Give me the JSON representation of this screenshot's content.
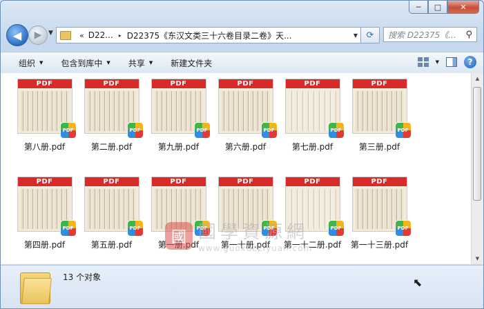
{
  "window": {
    "caption": {
      "minimize": "─",
      "maximize": "□",
      "close": "✕"
    }
  },
  "nav": {
    "back": "◀",
    "forward": "▶",
    "history_dropdown": "▼",
    "address": {
      "overflow": "«",
      "crumb1": "D22...",
      "separator": "▸",
      "crumb2": "D22375《东汉文类三十六卷目录二卷》天...",
      "dropdown": "▼"
    },
    "refresh": "⟳",
    "search_placeholder": "搜索 D22375《...",
    "search_icon": "⚲"
  },
  "toolbar": {
    "organize": "组织",
    "include_library": "包含到库中",
    "share": "共享",
    "new_folder": "新建文件夹",
    "dropdown_glyph": "▼",
    "help": "?"
  },
  "files": [
    {
      "name": "第八册.pdf",
      "band": "PDF",
      "badge": "PDF"
    },
    {
      "name": "第二册.pdf",
      "band": "PDF",
      "badge": "PDF"
    },
    {
      "name": "第九册.pdf",
      "band": "PDF",
      "badge": "PDF"
    },
    {
      "name": "第六册.pdf",
      "band": "PDF",
      "badge": "PDF"
    },
    {
      "name": "第七册.pdf",
      "band": "PDF",
      "badge": "PDF"
    },
    {
      "name": "第三册.pdf",
      "band": "PDF",
      "badge": "PDF"
    },
    {
      "name": "第四册.pdf",
      "band": "PDF",
      "badge": "PDF"
    },
    {
      "name": "第五册.pdf",
      "band": "PDF",
      "badge": "PDF"
    },
    {
      "name": "第一册.pdf",
      "band": "PDF",
      "badge": "PDF"
    },
    {
      "name": "第一十册.pdf",
      "band": "PDF",
      "badge": "PDF"
    },
    {
      "name": "第一十二册.pdf",
      "band": "PDF",
      "badge": "PDF"
    },
    {
      "name": "第一十三册.pdf",
      "band": "PDF",
      "badge": "PDF"
    }
  ],
  "watermark": {
    "seal": "國",
    "title": "國學資源網",
    "url": "www.guoxueziyuan.com"
  },
  "scrollbar": {
    "up": "▲",
    "down": "▼"
  },
  "status": {
    "count": "13 个对象"
  }
}
